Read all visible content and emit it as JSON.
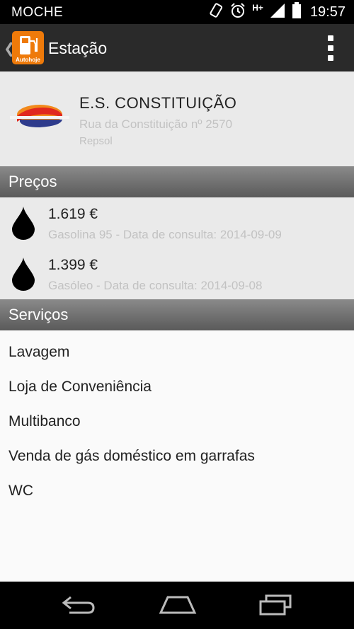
{
  "status_bar": {
    "carrier": "MOCHE",
    "network_label": "H+",
    "time": "19:57",
    "icons": [
      "rotation-icon",
      "alarm-icon",
      "signal-icon",
      "battery-icon"
    ]
  },
  "action_bar": {
    "title": "Estação",
    "logo_text": "Autohoje",
    "icons": [
      "back-chevron-icon",
      "fuel-pump-icon",
      "overflow-menu-icon"
    ]
  },
  "station": {
    "name": "E.S. CONSTITUIÇÃO",
    "address": "Rua da Constituição nº 2570",
    "brand": "Repsol"
  },
  "prices": {
    "header": "Preços",
    "items": [
      {
        "value": "1.619 €",
        "meta": "Gasolina 95 - Data de consulta: 2014-09-09"
      },
      {
        "value": "1.399 €",
        "meta": "Gasóleo - Data de consulta: 2014-09-08"
      }
    ]
  },
  "services": {
    "header": "Serviços",
    "items": [
      "Lavagem",
      "Loja de Conveniência",
      "Multibanco",
      "Venda de gás doméstico em garrafas",
      "WC"
    ]
  },
  "nav_bar": {
    "icons": [
      "back-icon",
      "home-icon",
      "recents-icon"
    ]
  },
  "colors": {
    "accent": "#ee7a0a",
    "action_bar": "#2a2a2a",
    "section_header": "#6b6b6b",
    "repsol_orange": "#f28a1c",
    "repsol_red": "#e0281e",
    "repsol_blue": "#2e3b8c"
  }
}
